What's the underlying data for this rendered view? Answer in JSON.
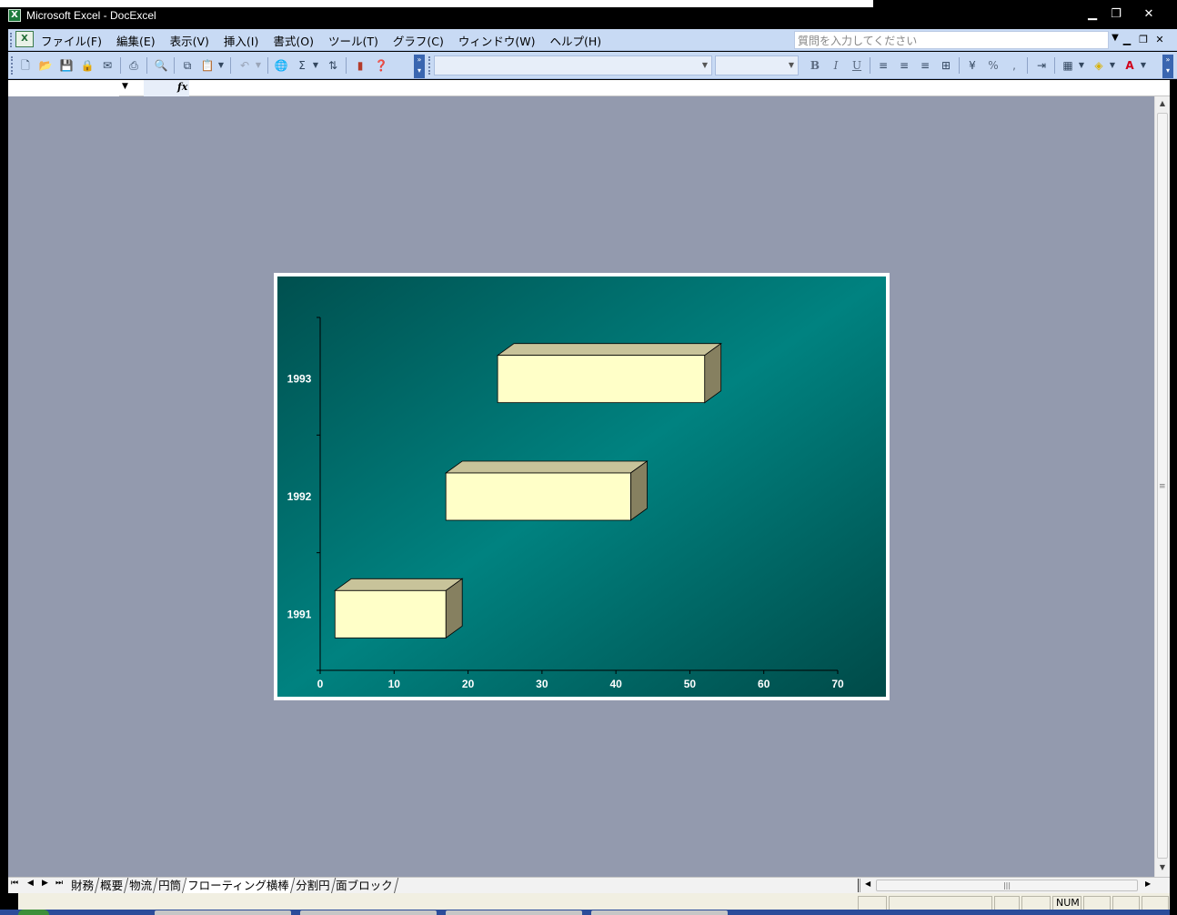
{
  "window": {
    "title": "Microsoft Excel - DocExcel",
    "min_icon": "minimize-icon",
    "restore_icon": "restore-icon",
    "close_icon": "close-icon"
  },
  "menubar": {
    "items": [
      "ファイル(F)",
      "編集(E)",
      "表示(V)",
      "挿入(I)",
      "書式(O)",
      "ツール(T)",
      "グラフ(C)",
      "ウィンドウ(W)",
      "ヘルプ(H)"
    ],
    "ask_placeholder": "質問を入力してください"
  },
  "formula_bar": {
    "fx": "fx"
  },
  "chart_data": {
    "type": "bar",
    "orientation": "horizontal-floating-3d",
    "categories": [
      "1991",
      "1992",
      "1993"
    ],
    "series": [
      {
        "start": [
          2,
          17,
          24
        ],
        "end": [
          17,
          42,
          52
        ]
      }
    ],
    "xlim": [
      0,
      70
    ],
    "xticks": [
      "0",
      "10",
      "20",
      "30",
      "40",
      "50",
      "60",
      "70"
    ],
    "grid": false,
    "legend": "none",
    "colors": {
      "bar_front": "#ffffc8",
      "bar_top": "#c8c39a",
      "bar_side": "#868060",
      "background": "#007a78",
      "text": "#ffffff"
    }
  },
  "sheet_tabs": [
    "財務",
    "概要",
    "物流",
    "円筒",
    "フローティング横棒",
    "分割円",
    "面ブロック"
  ],
  "active_tab": 4,
  "statusbar": {
    "num": "NUM"
  }
}
